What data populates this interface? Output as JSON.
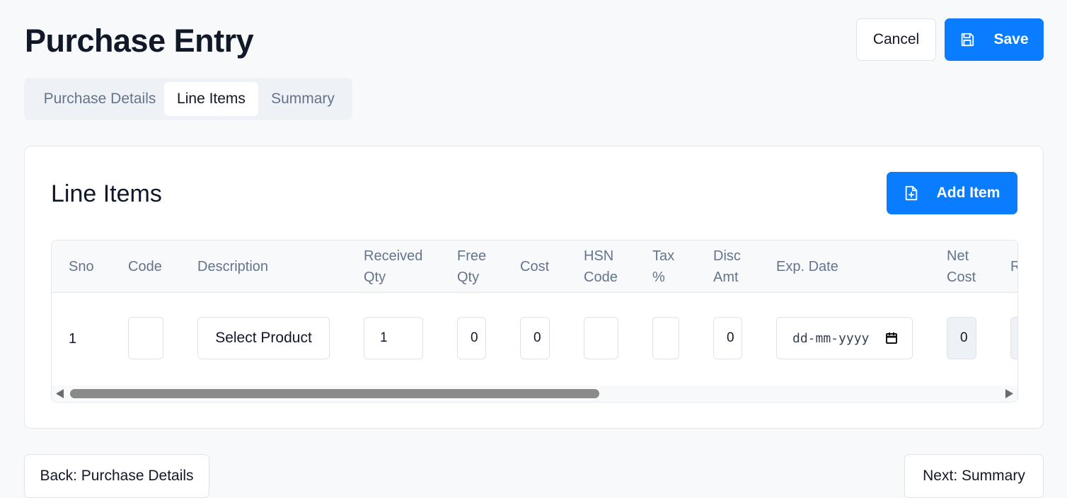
{
  "page": {
    "title": "Purchase Entry"
  },
  "header": {
    "cancel_label": "Cancel",
    "save_label": "Save"
  },
  "tabs": [
    {
      "label": "Purchase Details",
      "active": false
    },
    {
      "label": "Line Items",
      "active": true
    },
    {
      "label": "Summary",
      "active": false
    }
  ],
  "card": {
    "title": "Line Items",
    "add_item_label": "Add Item"
  },
  "table": {
    "columns": [
      "Sno",
      "Code",
      "Description",
      "Received\nQty",
      "Free\nQty",
      "Cost",
      "HSN\nCode",
      "Tax\n%",
      "Disc\nAmt",
      "Exp. Date",
      "Net\nCost",
      "R"
    ],
    "rows": [
      {
        "sno": "1",
        "code": "",
        "description_button": "Select Product",
        "received_qty": "1",
        "free_qty": "0",
        "cost": "0",
        "hsn_code": "",
        "tax_pct": "",
        "disc_amt": "0",
        "exp_date_placeholder": "dd-mm-yyyy",
        "net_cost": "0"
      }
    ]
  },
  "footer": {
    "back_label": "Back: Purchase Details",
    "next_label": "Next: Summary"
  },
  "colors": {
    "primary": "#0a7cff",
    "background": "#f8f9fb",
    "muted_text": "#64748b"
  },
  "icons": {
    "save": "floppy-disk-icon",
    "add_item": "file-plus-icon",
    "calendar": "calendar-icon"
  }
}
